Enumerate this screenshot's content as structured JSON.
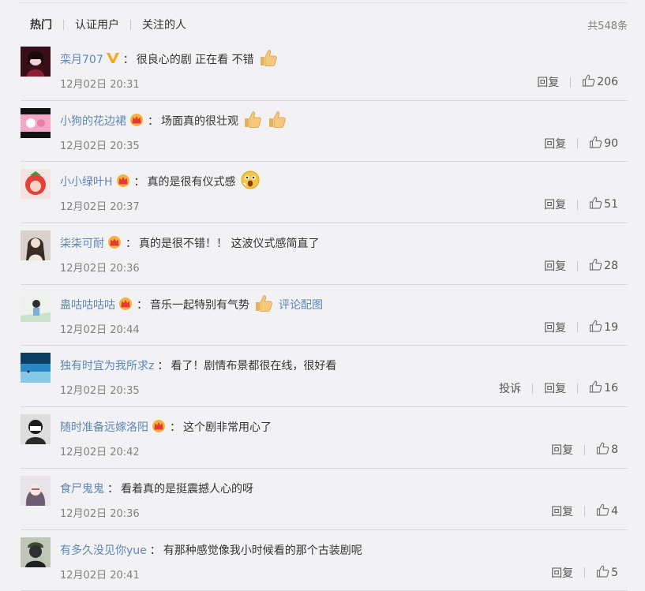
{
  "tabs": [
    {
      "label": "热门",
      "active": true
    },
    {
      "label": "认证用户",
      "active": false
    },
    {
      "label": "关注的人",
      "active": false
    }
  ],
  "total_label": "共548条",
  "reply_label": "回复",
  "report_label": "投诉",
  "colors": {
    "username": "#5b86b3",
    "background": "#f2f2f5",
    "time": "#808080"
  },
  "comments": [
    {
      "user": "栾月707",
      "badge": "v-icon",
      "text": "很良心的剧 正在看 不错",
      "emojis": [
        "thumbs-up-emoji"
      ],
      "extra": "",
      "time": "12月02日 20:31",
      "likes": "206",
      "report": false
    },
    {
      "user": "小狗的花边裙",
      "badge": "crown-icon",
      "text": "场面真的很壮观",
      "emojis": [
        "thumbs-up-emoji",
        "thumbs-up-emoji"
      ],
      "extra": "",
      "time": "12月02日 20:35",
      "likes": "90",
      "report": false
    },
    {
      "user": "小小绿叶H",
      "badge": "crown-icon",
      "text": "真的是很有仪式感",
      "emojis": [
        "surprised-face-emoji"
      ],
      "extra": "",
      "time": "12月02日 20:37",
      "likes": "51",
      "report": false
    },
    {
      "user": "柒柒可耐",
      "badge": "crown-icon",
      "text": "真的是很不错！！ 这波仪式感简直了",
      "emojis": [],
      "extra": "",
      "time": "12月02日 20:36",
      "likes": "28",
      "report": false
    },
    {
      "user": "蛊咕咕咕咕",
      "badge": "crown-icon",
      "text": "音乐一起特别有气势",
      "emojis": [
        "thumbs-up-emoji"
      ],
      "extra": "评论配图",
      "time": "12月02日 20:44",
      "likes": "19",
      "report": false
    },
    {
      "user": "独有时宜为我所求z",
      "badge": "",
      "text": "看了！剧情布景都很在线，很好看",
      "emojis": [],
      "extra": "",
      "time": "12月02日 20:35",
      "likes": "16",
      "report": true
    },
    {
      "user": "随时准备远嫁洛阳",
      "badge": "crown-icon",
      "text": "这个剧非常用心了",
      "emojis": [],
      "extra": "",
      "time": "12月02日 20:42",
      "likes": "8",
      "report": false
    },
    {
      "user": "食尸鬼鬼",
      "badge": "",
      "text": "看着真的是挺震撼人心的呀",
      "emojis": [],
      "extra": "",
      "time": "12月02日 20:36",
      "likes": "4",
      "report": false
    },
    {
      "user": "有多久没见你yue",
      "badge": "",
      "text": "有那种感觉像我小时候看的那个古装剧呢",
      "emojis": [],
      "extra": "",
      "time": "12月02日 20:41",
      "likes": "5",
      "report": false
    }
  ]
}
